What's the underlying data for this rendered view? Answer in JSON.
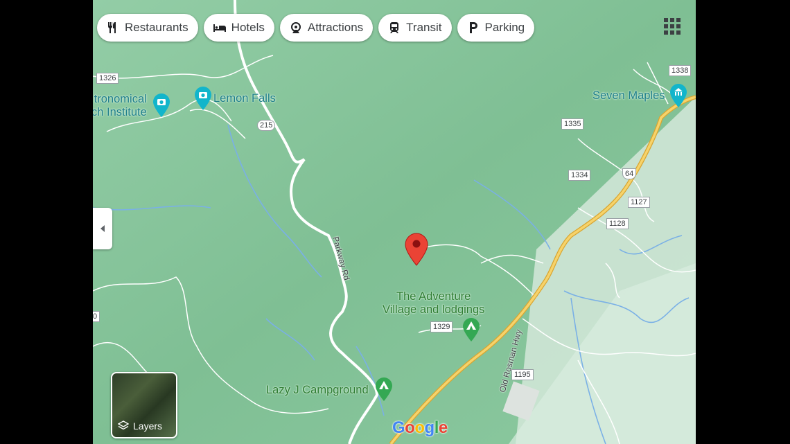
{
  "chips": [
    {
      "label": "Restaurants",
      "icon": "fork-knife-icon"
    },
    {
      "label": "Hotels",
      "icon": "bed-icon"
    },
    {
      "label": "Attractions",
      "icon": "attractions-icon"
    },
    {
      "label": "Transit",
      "icon": "train-icon"
    },
    {
      "label": "Parking",
      "icon": "parking-icon"
    }
  ],
  "pois": {
    "astronomical": "tronomical\nch Institute",
    "astronomical_l1": "tronomical",
    "astronomical_l2": "ch Institute",
    "lemon_falls": "Lemon Falls",
    "seven_maples": "Seven Maples",
    "adventure_l1": "The Adventure",
    "adventure_l2": "Village and lodgings",
    "lazy_j": "Lazy J Campground"
  },
  "roads": {
    "r1326": "1326",
    "r215": "215",
    "r1338": "1338",
    "r1335": "1335",
    "r1334": "1334",
    "r64": "64",
    "r1127": "1127",
    "r1128": "1128",
    "r1329": "1329",
    "r1195": "1195",
    "parkway": "Parkway Rd",
    "old_rosman": "Old Rosman Hwy",
    "edge_left": "0"
  },
  "layers_label": "Layers",
  "brand": "Google",
  "colors": {
    "map_green": "#8cc9a0",
    "highway": "#f6c84a",
    "pin": "#e53935",
    "poi_teal": "#1e7f8a",
    "poi_green": "#2e7d32"
  }
}
